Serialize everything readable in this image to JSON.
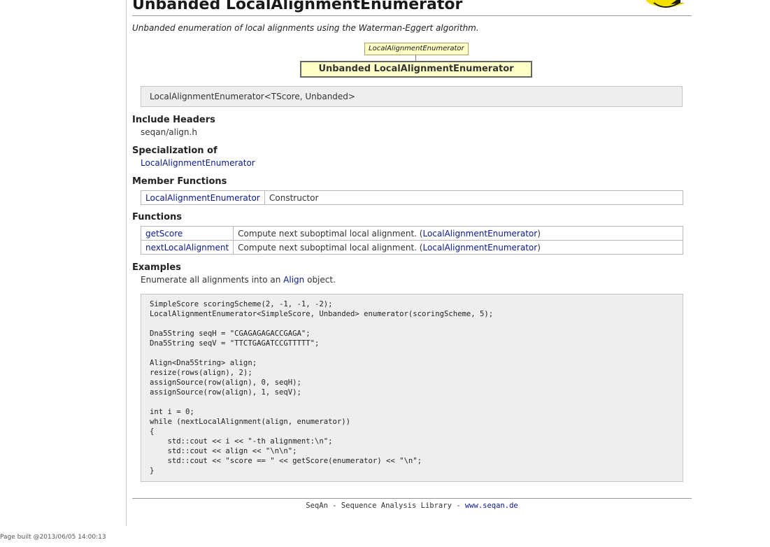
{
  "page": {
    "title": "Unbanded LocalAlignmentEnumerator",
    "summary": "Unbanded enumeration of local alignments using the Waterman-Eggert algorithm.",
    "built": "Page built @2013/06/05 14:00:13"
  },
  "hierarchy": {
    "parent": "LocalAlignmentEnumerator",
    "self": "Unbanded LocalAlignmentEnumerator"
  },
  "signature": "LocalAlignmentEnumerator<TScore, Unbanded>",
  "include_headers": {
    "heading": "Include Headers",
    "value": "seqan/align.h"
  },
  "specialization_of": {
    "heading": "Specialization of",
    "link": "LocalAlignmentEnumerator"
  },
  "member_functions": {
    "heading": "Member Functions",
    "rows": [
      {
        "name": "LocalAlignmentEnumerator",
        "desc": "Constructor"
      }
    ]
  },
  "functions": {
    "heading": "Functions",
    "rows": [
      {
        "name": "getScore",
        "desc": "Compute next suboptimal local alignment. (",
        "link": "LocalAlignmentEnumerator",
        "close": ")"
      },
      {
        "name": "nextLocalAlignment",
        "desc": "Compute next suboptimal local alignment. (",
        "link": "LocalAlignmentEnumerator",
        "close": ")"
      }
    ]
  },
  "examples": {
    "heading": "Examples",
    "text_before": "Enumerate all alignments into an ",
    "text_link": "Align",
    "text_after": " object.",
    "code": "SimpleScore scoringScheme(2, -1, -1, -2);\nLocalAlignmentEnumerator<SimpleScore, Unbanded> enumerator(scoringScheme, 5);\n\nDna5String seqH = \"CGAGAGAGACCGAGA\";\nDna5String seqV = \"TTCTGAGATCCGTTTTT\";\n\nAlign<Dna5String> align;\nresize(rows(align), 2);\nassignSource(row(align), 0, seqH);\nassignSource(row(align), 1, seqV);\n\nint i = 0;\nwhile (nextLocalAlignment(align, enumerator))\n{\n    std::cout << i << \"-th alignment:\\n\";\n    std::cout << align << \"\\n\\n\";\n    std::cout << \"score == \" << getScore(enumerator) << \"\\n\";\n}"
  },
  "footer": {
    "text": "SeqAn - Sequence Analysis Library - ",
    "link": "www.seqan.de"
  },
  "logo": {
    "icon": "seqan-logo-icon"
  }
}
